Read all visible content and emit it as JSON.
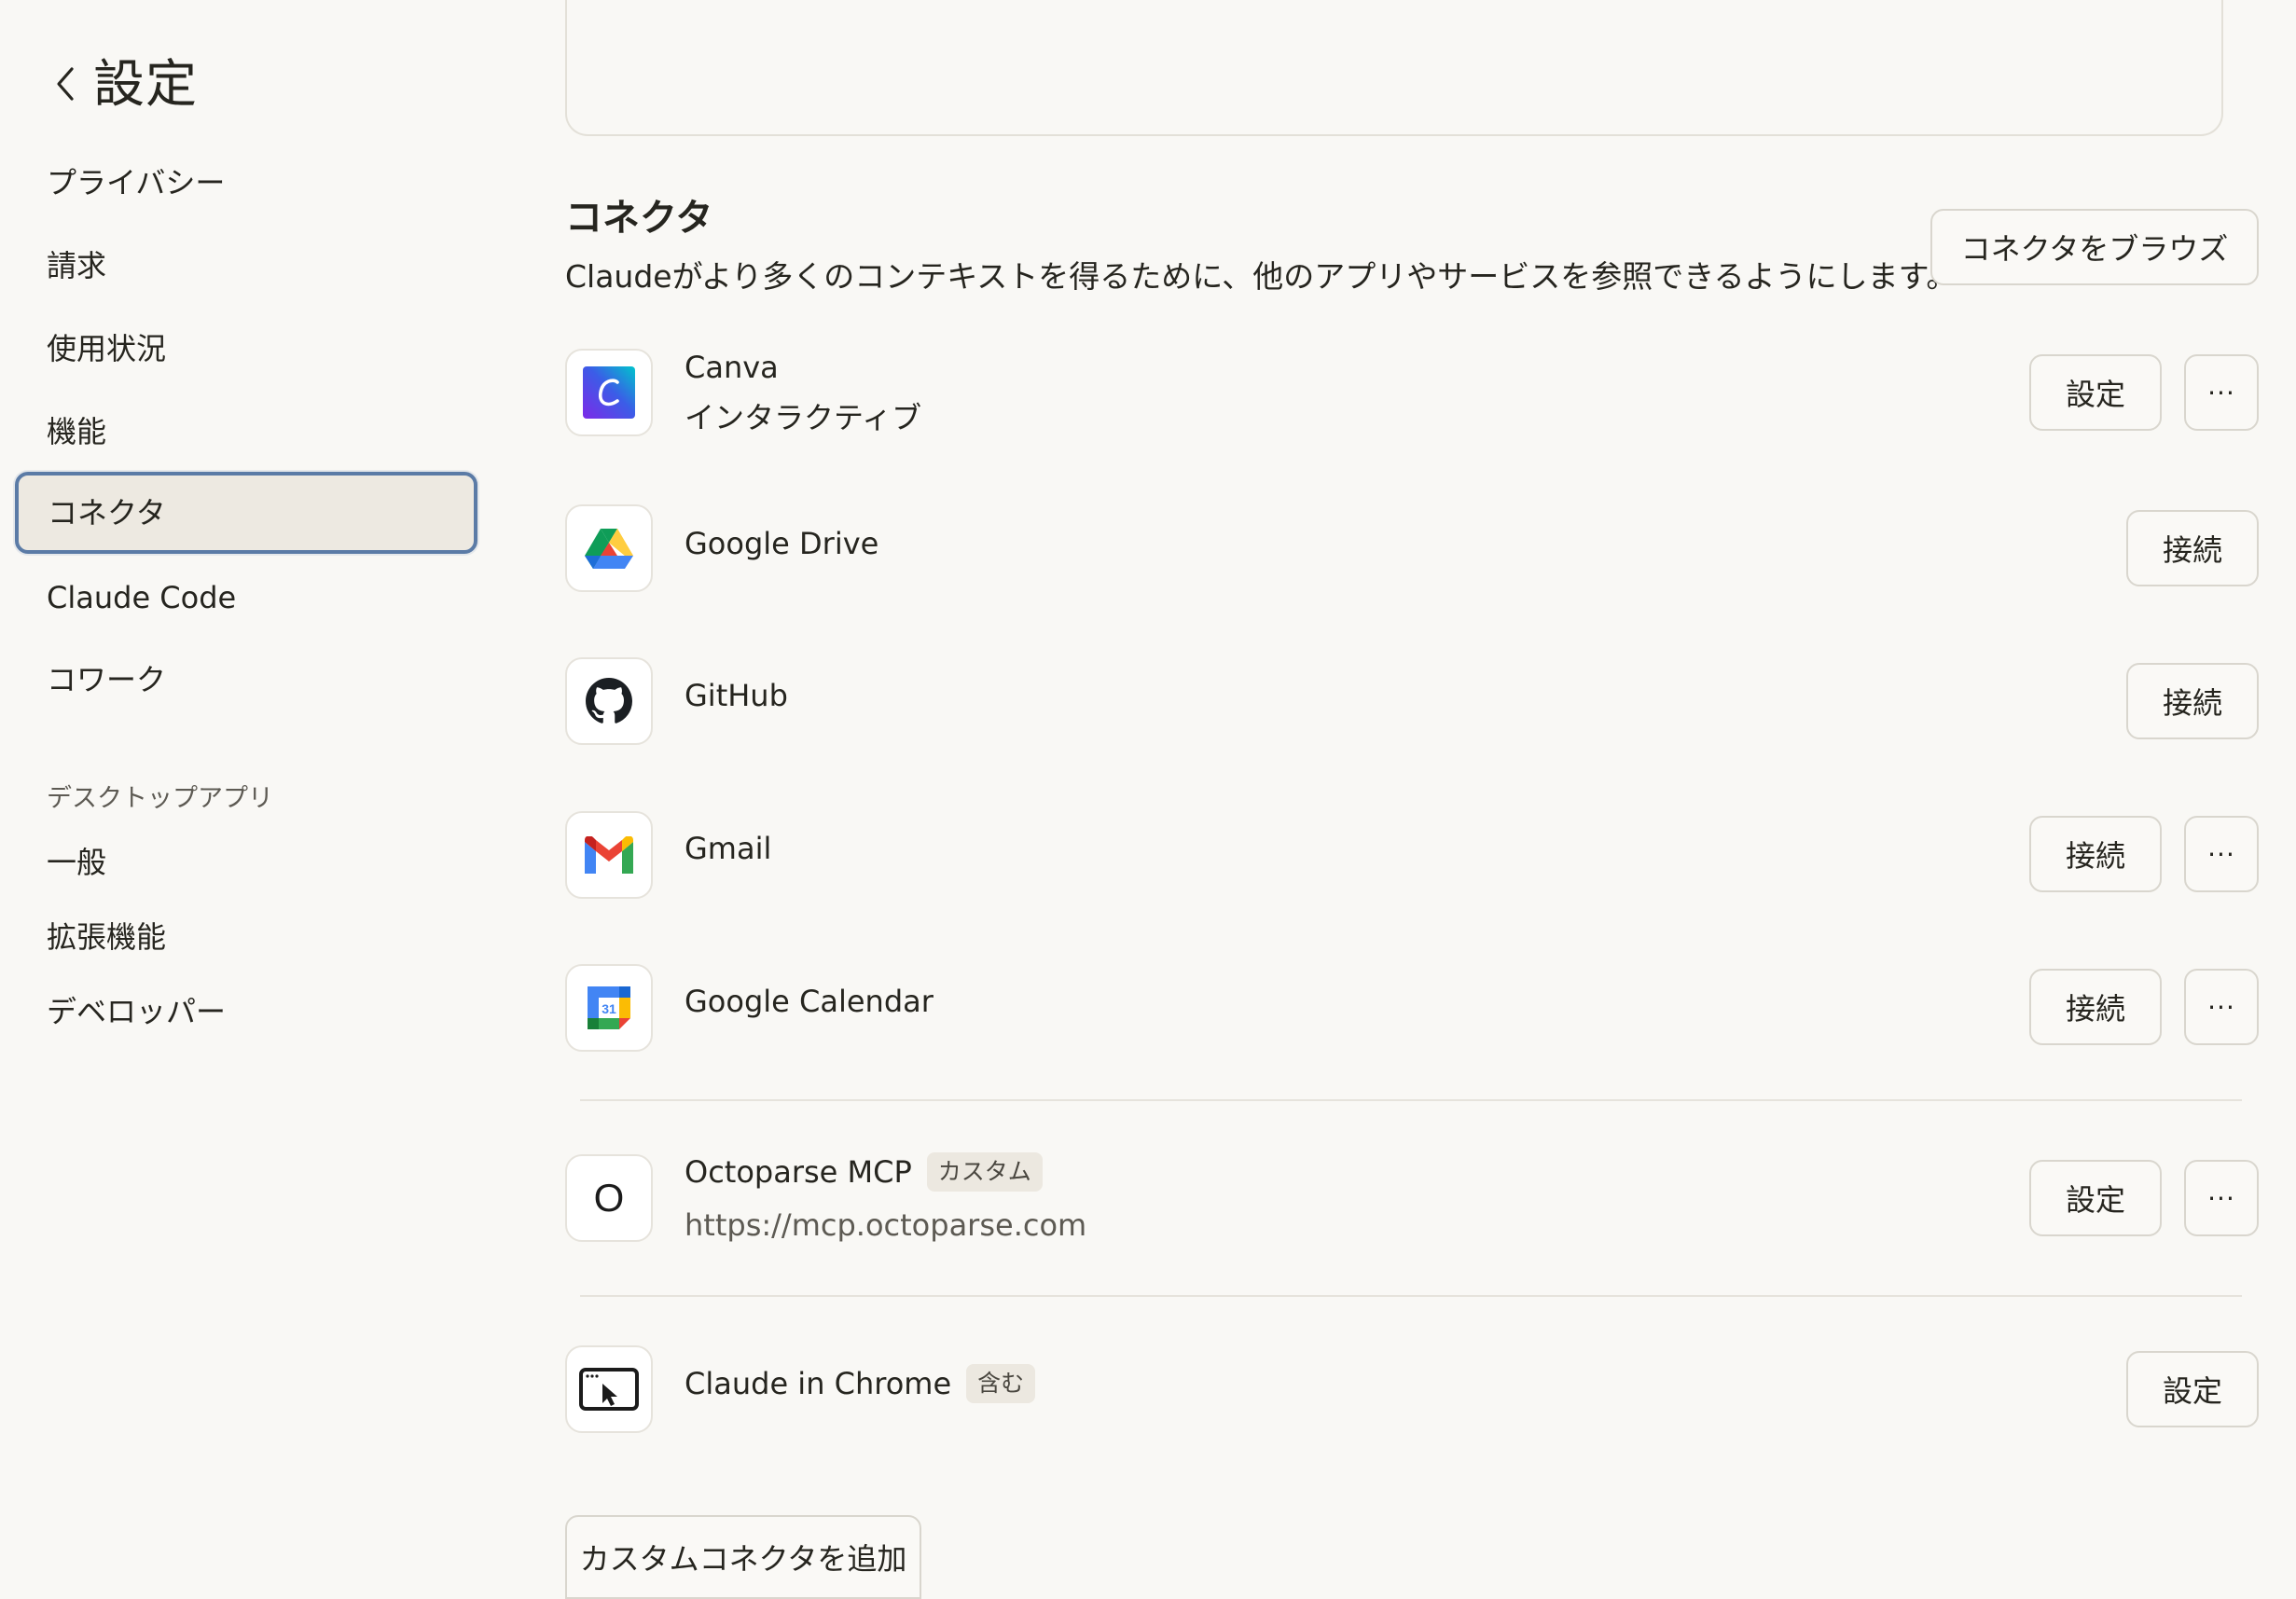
{
  "header": {
    "title": "設定"
  },
  "sidebar": {
    "items": [
      {
        "label": "プライバシー"
      },
      {
        "label": "請求"
      },
      {
        "label": "使用状況"
      },
      {
        "label": "機能"
      },
      {
        "label": "コネクタ",
        "active": true
      },
      {
        "label": "Claude Code"
      },
      {
        "label": "コワーク"
      }
    ],
    "section_label": "デスクトップアプリ",
    "desktop_items": [
      {
        "label": "一般"
      },
      {
        "label": "拡張機能"
      },
      {
        "label": "デベロッパー"
      }
    ]
  },
  "main": {
    "title": "コネクタ",
    "description": "Claudeがより多くのコンテキストを得るために、他のアプリやサービスを参照できるようにします。",
    "browse_label": "コネクタをブラウズ",
    "connectors": [
      {
        "name": "Canva",
        "subtitle": "インタラクティブ",
        "icon": "canva-icon",
        "primary_label": "設定",
        "more_label": "···"
      },
      {
        "name": "Google Drive",
        "icon": "google-drive-icon",
        "primary_label": "接続"
      },
      {
        "name": "GitHub",
        "icon": "github-icon",
        "primary_label": "接続"
      },
      {
        "name": "Gmail",
        "icon": "gmail-icon",
        "primary_label": "接続",
        "more_label": "···"
      },
      {
        "name": "Google Calendar",
        "icon": "google-calendar-icon",
        "icon_text": "31",
        "primary_label": "接続",
        "more_label": "···"
      },
      {
        "name": "Octoparse MCP",
        "tag": "カスタム",
        "url": "https://mcp.octoparse.com",
        "icon": "octoparse-icon",
        "icon_text": "O",
        "primary_label": "設定",
        "more_label": "···"
      },
      {
        "name": "Claude in Chrome",
        "tag": "含む",
        "icon": "chrome-window-icon",
        "primary_label": "設定"
      }
    ],
    "add_custom_label": "カスタムコネクタを追加"
  },
  "colors": {
    "background": "#f9f8f5",
    "active_border": "#5b7ba6",
    "active_bg": "#ede9e1"
  }
}
